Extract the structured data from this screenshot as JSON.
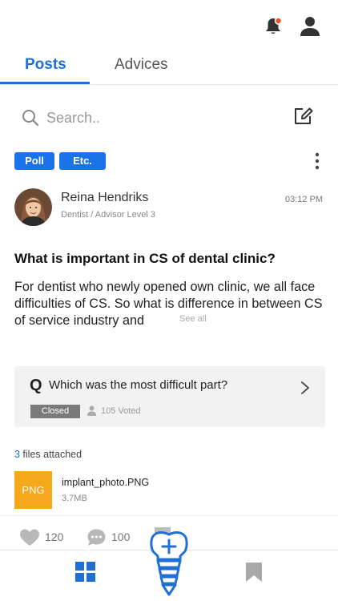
{
  "header": {
    "notification_icon": "bell-icon",
    "notification_dot_color": "#e8542a",
    "profile_icon": "user-icon"
  },
  "tabs": [
    {
      "label": "Posts",
      "active": true
    },
    {
      "label": "Advices",
      "active": false
    }
  ],
  "search": {
    "placeholder": "Search..",
    "compose_icon": "edit-icon"
  },
  "tags": [
    "Poll",
    "Etc."
  ],
  "post": {
    "author": {
      "name": "Reina Hendriks",
      "role": "Dentist / Advisor Level 3"
    },
    "time": "03:12 PM",
    "title": "What is important in CS of dental clinic?",
    "body": "For dentist who newly opened own clinic, we all face difficulties of CS. So what is difference in between CS of service industry and",
    "see_all": "See all",
    "poll": {
      "prefix": "Q",
      "question": "Which was the most difficult part?",
      "status": "Closed",
      "voted": "105 Voted"
    },
    "files": {
      "count": "3",
      "label": " files attached",
      "items": [
        {
          "thumb_label": "PNG",
          "name": "implant_photo.PNG",
          "size": "3.7MB"
        }
      ]
    },
    "likes": "120",
    "comments": "100"
  },
  "colors": {
    "accent": "#1f6fd6",
    "tag": "#1a73e8",
    "file_thumb": "#f5a81c",
    "fab": "#1f6fd6"
  },
  "bottom_nav": {
    "items": [
      "grid-icon",
      "add-implant-icon",
      "bookmark-icon"
    ]
  }
}
